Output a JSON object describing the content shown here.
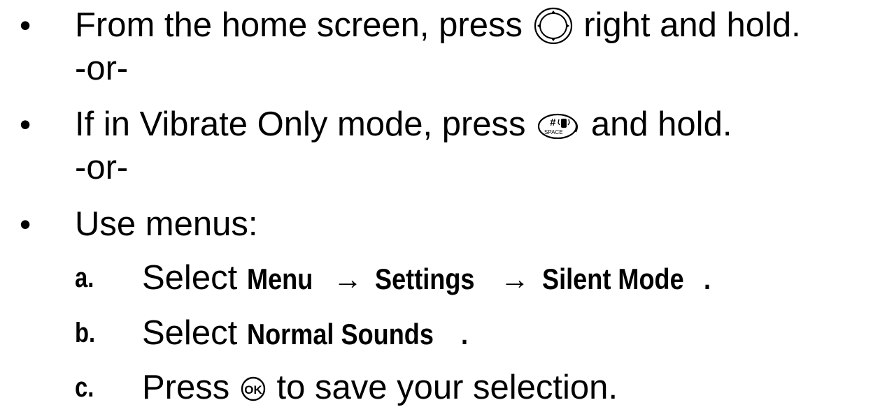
{
  "bullet_char": "•",
  "items": [
    {
      "before_key": "From the home screen, press",
      "key_icon": "navigation-key-icon",
      "after_key": "right and hold.",
      "separator": "-or-"
    },
    {
      "before_key": "If in Vibrate Only mode, press",
      "key_icon": "pound-space-vibrate-key-icon",
      "key_label_symbol": "#",
      "key_label_text": "SPACE",
      "after_key": "and hold.",
      "separator": "-or-"
    },
    {
      "text": "Use menus:",
      "steps": [
        {
          "marker": "a.",
          "prefix": "Select",
          "path": [
            "Menu",
            "Settings",
            "Silent Mode"
          ],
          "arrow": "→",
          "suffix": "."
        },
        {
          "marker": "b.",
          "prefix": "Select",
          "term": "Normal Sounds",
          "suffix": "."
        },
        {
          "marker": "c.",
          "prefix": "Press",
          "key_icon": "ok-key-icon",
          "key_label": "OK",
          "suffix": "to save your selection."
        }
      ]
    }
  ]
}
